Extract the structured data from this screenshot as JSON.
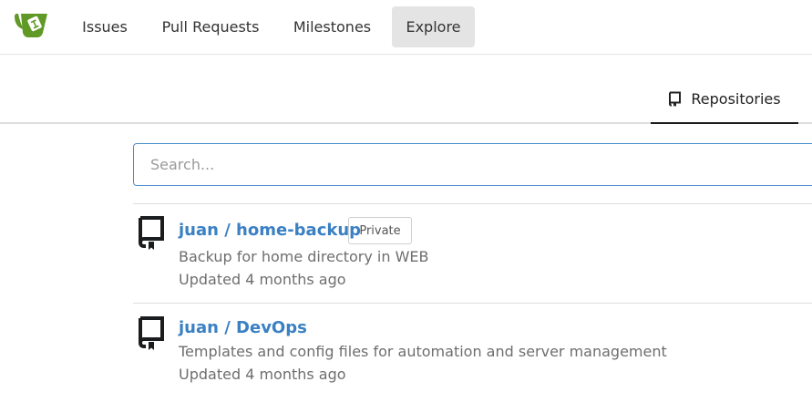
{
  "nav": {
    "items": [
      {
        "label": "Issues"
      },
      {
        "label": "Pull Requests"
      },
      {
        "label": "Milestones"
      },
      {
        "label": "Explore",
        "active": true
      }
    ]
  },
  "tabs": {
    "repositories_label": "Repositories",
    "repositories_icon": "repo-icon"
  },
  "search": {
    "placeholder": "Search...",
    "value": ""
  },
  "repos": [
    {
      "title": "juan / home-backup",
      "badge": "Private",
      "description": "Backup for home directory in WEB",
      "updated": "Updated 4 months ago",
      "icon": "repo-icon"
    },
    {
      "title": "juan / DevOps",
      "description": "Templates and config files for automation and server management",
      "updated": "Updated 4 months ago",
      "icon": "repo-icon"
    }
  ],
  "colors": {
    "link": "#3a80c3",
    "logo": "#609926",
    "active_nav_bg": "#e4e4e4",
    "search_border": "#4c8dcb"
  }
}
